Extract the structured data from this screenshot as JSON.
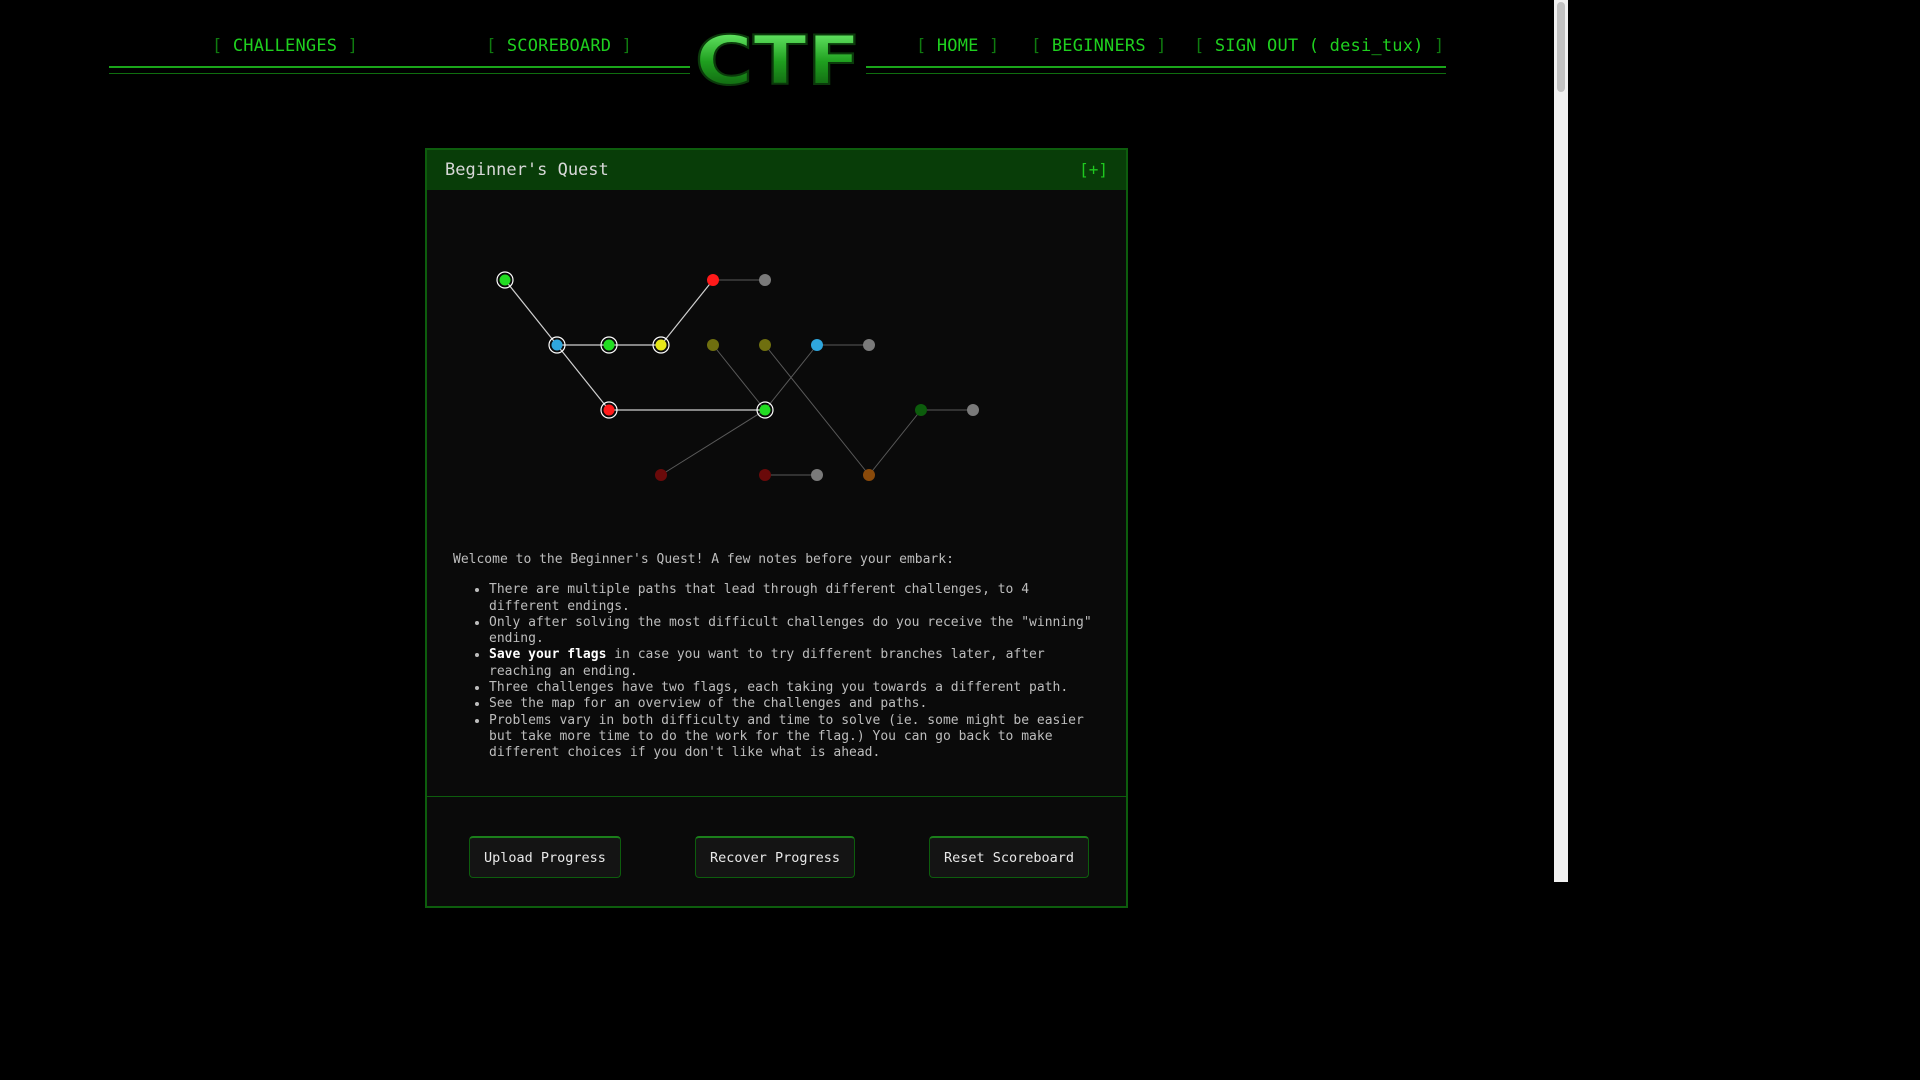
{
  "nav": {
    "left": [
      "CHALLENGES",
      "SCOREBOARD"
    ],
    "right": [
      "HOME",
      "BEGINNERS",
      "SIGN OUT ( desi_tux)"
    ],
    "logo_text": "CTF",
    "accent": "#1fd01f"
  },
  "panel": {
    "title": "Beginner's Quest",
    "toggle": "[+]",
    "intro": "Welcome to the Beginner's Quest! A few notes before your embark:",
    "notes": {
      "n1": "There are multiple paths that lead through different challenges, to 4 different endings.",
      "n2": "Only after solving the most difficult challenges do you receive the \"winning\" ending.",
      "n3_bold": "Save your flags",
      "n3_rest": " in case you want to try different branches later, after reaching an ending.",
      "n4": "Three challenges have two flags, each taking you towards a different path.",
      "n5": "See the map for an overview of the challenges and paths.",
      "n6": "Problems vary in both difficulty and time to solve (ie. some might be easier but take more time to do the work for the flag.) You can go back to make different choices if you don't like what is ahead."
    },
    "buttons": {
      "upload": "Upload Progress",
      "recover": "Recover Progress",
      "reset": "Reset Scoreboard"
    }
  },
  "quest_map": {
    "colors": {
      "green": "#22dd22",
      "blue": "#2fa6dd",
      "yellow": "#e6e619",
      "red": "#ff1a1a",
      "gray": "#7a7a7a",
      "olive": "#6f6f0f",
      "dark_red": "#6a0a0a",
      "dark_orange": "#8a4a0a",
      "dark_green": "#0c5c0c"
    },
    "nodes": [
      {
        "id": "a",
        "col": 0,
        "row": 0,
        "color": "green",
        "solved": true
      },
      {
        "id": "b",
        "col": 1,
        "row": 1,
        "color": "blue",
        "solved": true
      },
      {
        "id": "c",
        "col": 2,
        "row": 1,
        "color": "green",
        "solved": true
      },
      {
        "id": "d",
        "col": 3,
        "row": 1,
        "color": "yellow",
        "solved": true
      },
      {
        "id": "e",
        "col": 4,
        "row": 0,
        "color": "red",
        "solved": false
      },
      {
        "id": "f",
        "col": 5,
        "row": 0,
        "color": "gray",
        "solved": false
      },
      {
        "id": "g",
        "col": 2,
        "row": 2,
        "color": "red",
        "solved": true
      },
      {
        "id": "h",
        "col": 5,
        "row": 2,
        "color": "green",
        "solved": true
      },
      {
        "id": "i",
        "col": 4,
        "row": 1,
        "color": "olive",
        "solved": false
      },
      {
        "id": "j",
        "col": 5,
        "row": 1,
        "color": "olive",
        "solved": false
      },
      {
        "id": "k",
        "col": 6,
        "row": 1,
        "color": "blue",
        "solved": false
      },
      {
        "id": "l",
        "col": 7,
        "row": 1,
        "color": "gray",
        "solved": false
      },
      {
        "id": "m",
        "col": 3,
        "row": 3,
        "color": "dark_red",
        "solved": false
      },
      {
        "id": "n",
        "col": 5,
        "row": 3,
        "color": "dark_red",
        "solved": false
      },
      {
        "id": "o",
        "col": 6,
        "row": 3,
        "color": "gray",
        "solved": false
      },
      {
        "id": "p",
        "col": 7,
        "row": 3,
        "color": "dark_orange",
        "solved": false
      },
      {
        "id": "q",
        "col": 8,
        "row": 2,
        "color": "dark_green",
        "solved": false
      },
      {
        "id": "r",
        "col": 9,
        "row": 2,
        "color": "gray",
        "solved": false
      }
    ],
    "edges": [
      [
        "a",
        "b"
      ],
      [
        "b",
        "c"
      ],
      [
        "c",
        "d"
      ],
      [
        "d",
        "e"
      ],
      [
        "e",
        "f"
      ],
      [
        "b",
        "g"
      ],
      [
        "g",
        "h"
      ],
      [
        "h",
        "i"
      ],
      [
        "h",
        "k"
      ],
      [
        "k",
        "l"
      ],
      [
        "h",
        "m"
      ],
      [
        "j",
        "p"
      ],
      [
        "n",
        "o"
      ],
      [
        "p",
        "q"
      ],
      [
        "q",
        "r"
      ]
    ]
  }
}
